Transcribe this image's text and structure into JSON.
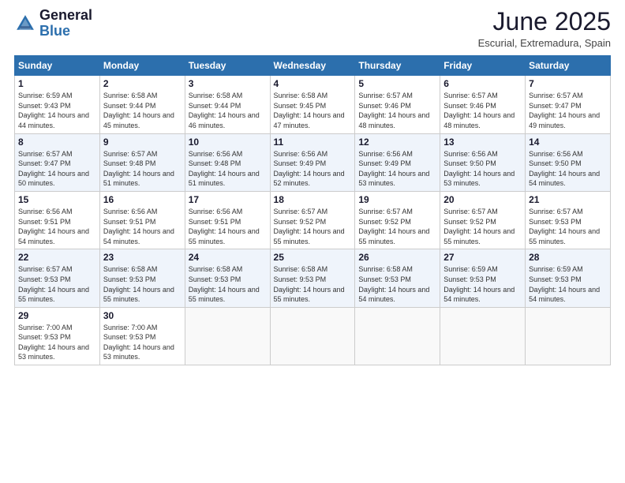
{
  "header": {
    "logo_general": "General",
    "logo_blue": "Blue",
    "month_title": "June 2025",
    "location": "Escurial, Extremadura, Spain"
  },
  "weekdays": [
    "Sunday",
    "Monday",
    "Tuesday",
    "Wednesday",
    "Thursday",
    "Friday",
    "Saturday"
  ],
  "weeks": [
    [
      {
        "day": "1",
        "sunrise": "6:59 AM",
        "sunset": "9:43 PM",
        "daylight": "14 hours and 44 minutes."
      },
      {
        "day": "2",
        "sunrise": "6:58 AM",
        "sunset": "9:44 PM",
        "daylight": "14 hours and 45 minutes."
      },
      {
        "day": "3",
        "sunrise": "6:58 AM",
        "sunset": "9:44 PM",
        "daylight": "14 hours and 46 minutes."
      },
      {
        "day": "4",
        "sunrise": "6:58 AM",
        "sunset": "9:45 PM",
        "daylight": "14 hours and 47 minutes."
      },
      {
        "day": "5",
        "sunrise": "6:57 AM",
        "sunset": "9:46 PM",
        "daylight": "14 hours and 48 minutes."
      },
      {
        "day": "6",
        "sunrise": "6:57 AM",
        "sunset": "9:46 PM",
        "daylight": "14 hours and 48 minutes."
      },
      {
        "day": "7",
        "sunrise": "6:57 AM",
        "sunset": "9:47 PM",
        "daylight": "14 hours and 49 minutes."
      }
    ],
    [
      {
        "day": "8",
        "sunrise": "6:57 AM",
        "sunset": "9:47 PM",
        "daylight": "14 hours and 50 minutes."
      },
      {
        "day": "9",
        "sunrise": "6:57 AM",
        "sunset": "9:48 PM",
        "daylight": "14 hours and 51 minutes."
      },
      {
        "day": "10",
        "sunrise": "6:56 AM",
        "sunset": "9:48 PM",
        "daylight": "14 hours and 51 minutes."
      },
      {
        "day": "11",
        "sunrise": "6:56 AM",
        "sunset": "9:49 PM",
        "daylight": "14 hours and 52 minutes."
      },
      {
        "day": "12",
        "sunrise": "6:56 AM",
        "sunset": "9:49 PM",
        "daylight": "14 hours and 53 minutes."
      },
      {
        "day": "13",
        "sunrise": "6:56 AM",
        "sunset": "9:50 PM",
        "daylight": "14 hours and 53 minutes."
      },
      {
        "day": "14",
        "sunrise": "6:56 AM",
        "sunset": "9:50 PM",
        "daylight": "14 hours and 54 minutes."
      }
    ],
    [
      {
        "day": "15",
        "sunrise": "6:56 AM",
        "sunset": "9:51 PM",
        "daylight": "14 hours and 54 minutes."
      },
      {
        "day": "16",
        "sunrise": "6:56 AM",
        "sunset": "9:51 PM",
        "daylight": "14 hours and 54 minutes."
      },
      {
        "day": "17",
        "sunrise": "6:56 AM",
        "sunset": "9:51 PM",
        "daylight": "14 hours and 55 minutes."
      },
      {
        "day": "18",
        "sunrise": "6:57 AM",
        "sunset": "9:52 PM",
        "daylight": "14 hours and 55 minutes."
      },
      {
        "day": "19",
        "sunrise": "6:57 AM",
        "sunset": "9:52 PM",
        "daylight": "14 hours and 55 minutes."
      },
      {
        "day": "20",
        "sunrise": "6:57 AM",
        "sunset": "9:52 PM",
        "daylight": "14 hours and 55 minutes."
      },
      {
        "day": "21",
        "sunrise": "6:57 AM",
        "sunset": "9:53 PM",
        "daylight": "14 hours and 55 minutes."
      }
    ],
    [
      {
        "day": "22",
        "sunrise": "6:57 AM",
        "sunset": "9:53 PM",
        "daylight": "14 hours and 55 minutes."
      },
      {
        "day": "23",
        "sunrise": "6:58 AM",
        "sunset": "9:53 PM",
        "daylight": "14 hours and 55 minutes."
      },
      {
        "day": "24",
        "sunrise": "6:58 AM",
        "sunset": "9:53 PM",
        "daylight": "14 hours and 55 minutes."
      },
      {
        "day": "25",
        "sunrise": "6:58 AM",
        "sunset": "9:53 PM",
        "daylight": "14 hours and 55 minutes."
      },
      {
        "day": "26",
        "sunrise": "6:58 AM",
        "sunset": "9:53 PM",
        "daylight": "14 hours and 54 minutes."
      },
      {
        "day": "27",
        "sunrise": "6:59 AM",
        "sunset": "9:53 PM",
        "daylight": "14 hours and 54 minutes."
      },
      {
        "day": "28",
        "sunrise": "6:59 AM",
        "sunset": "9:53 PM",
        "daylight": "14 hours and 54 minutes."
      }
    ],
    [
      {
        "day": "29",
        "sunrise": "7:00 AM",
        "sunset": "9:53 PM",
        "daylight": "14 hours and 53 minutes."
      },
      {
        "day": "30",
        "sunrise": "7:00 AM",
        "sunset": "9:53 PM",
        "daylight": "14 hours and 53 minutes."
      },
      null,
      null,
      null,
      null,
      null
    ]
  ]
}
